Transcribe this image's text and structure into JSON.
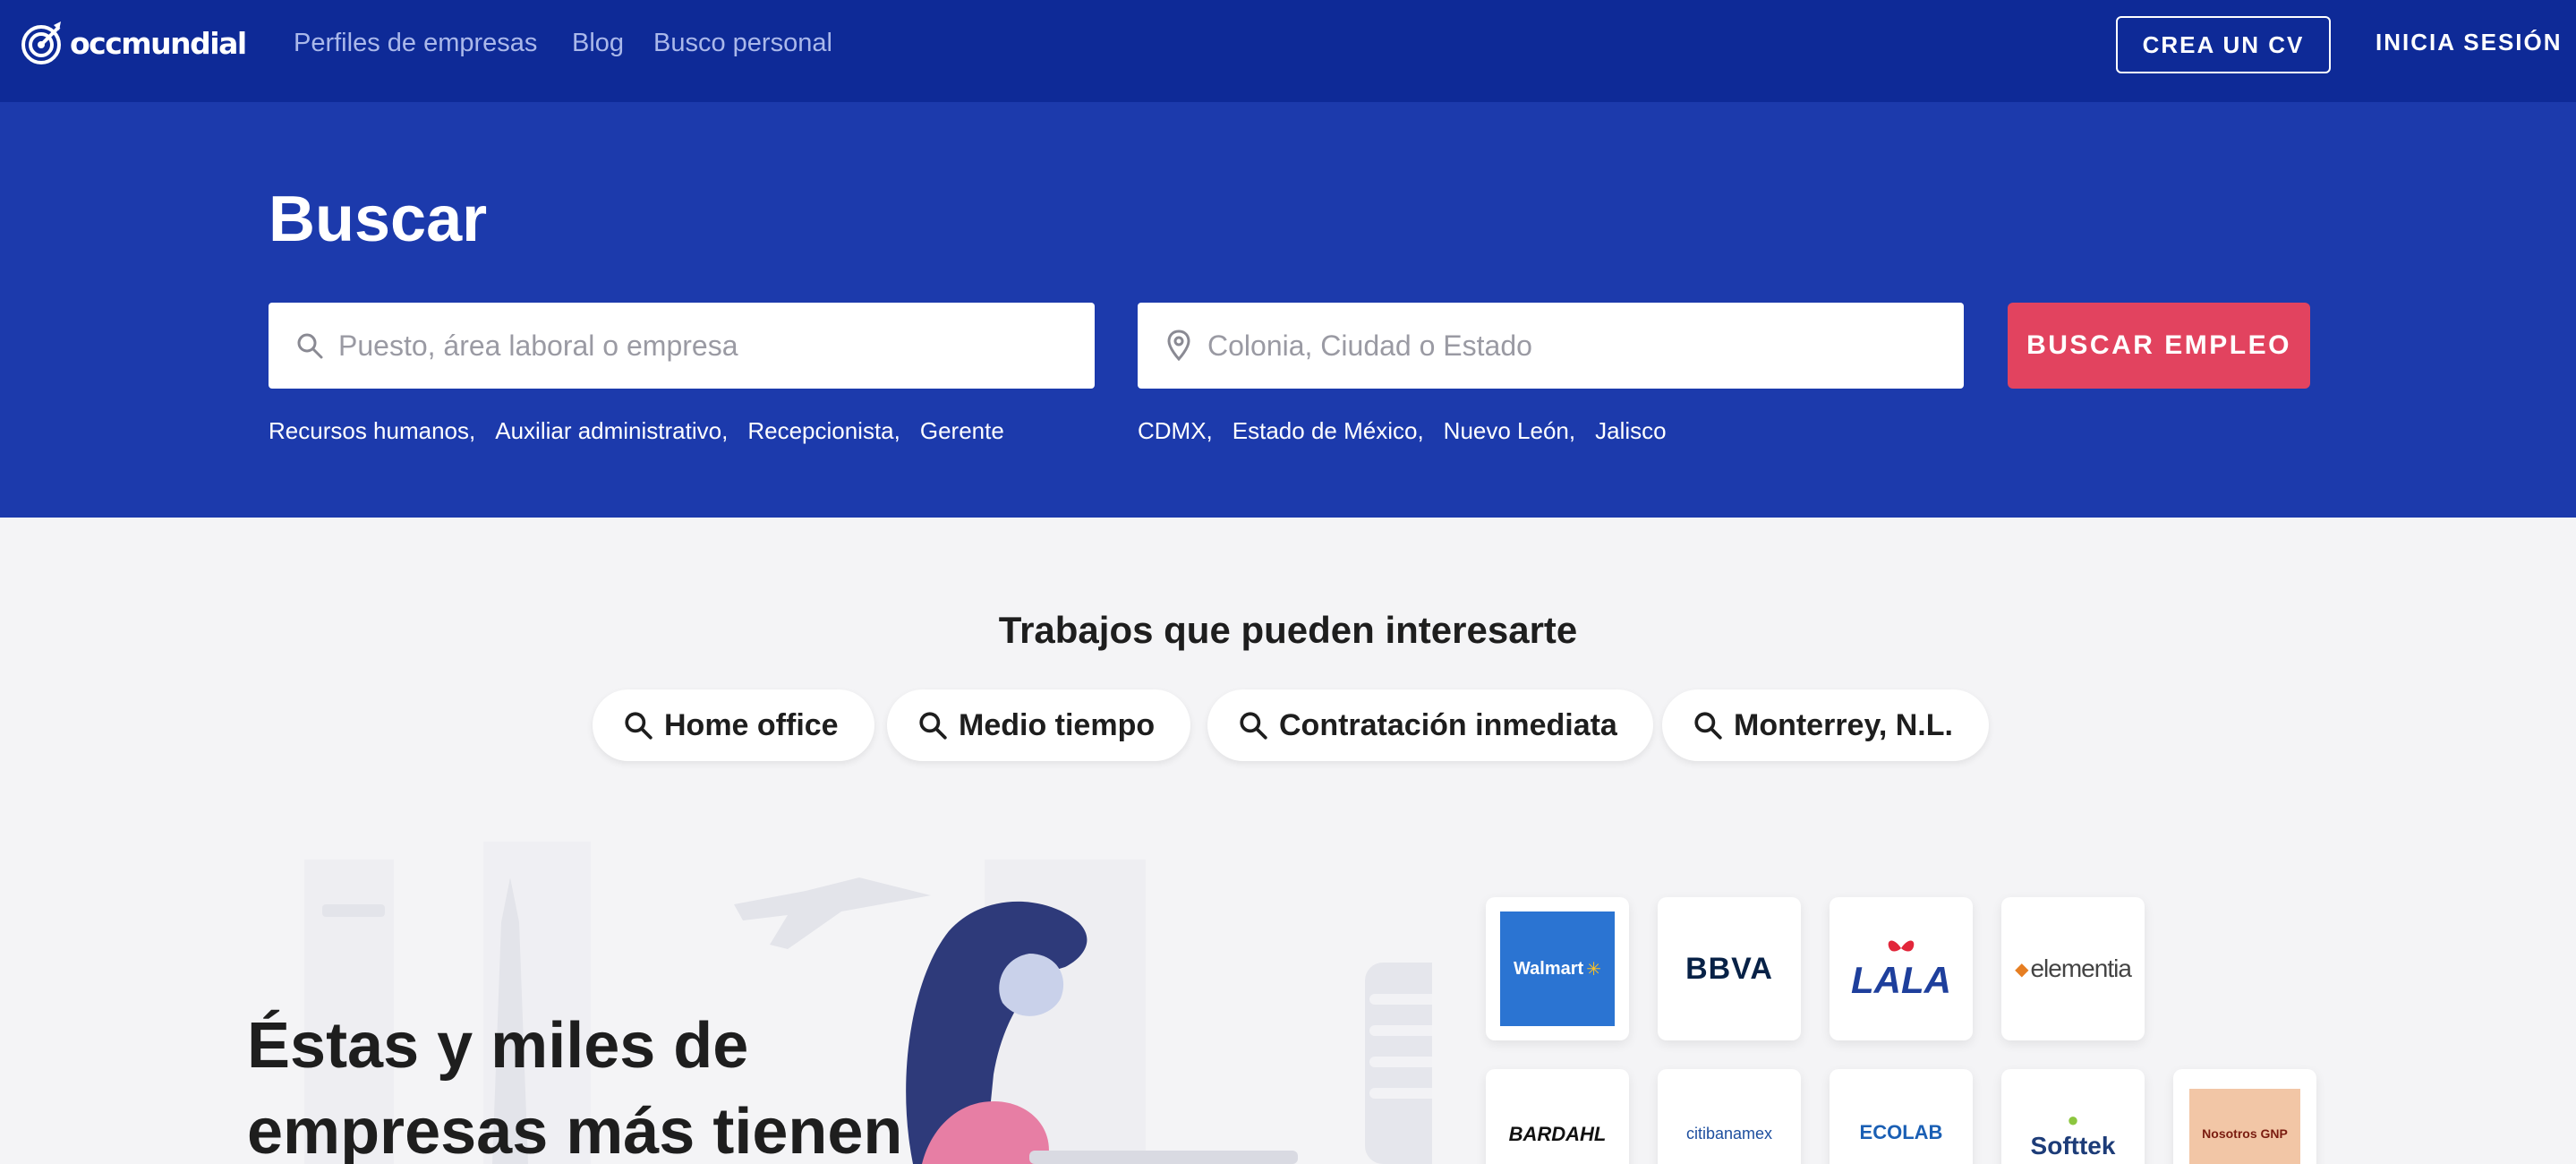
{
  "nav": {
    "logo_text": "occmundial",
    "links": [
      "Perfiles de empresas",
      "Blog",
      "Busco personal"
    ],
    "cv_button": "CREA UN CV",
    "login": "INICIA SESIÓN"
  },
  "hero": {
    "title": "Buscar",
    "search_placeholder": "Puesto, área laboral o empresa",
    "location_placeholder": "Colonia, Ciudad o Estado",
    "search_button": "BUSCAR EMPLEO",
    "job_suggestions": [
      "Recursos humanos,",
      "Auxiliar administrativo,",
      "Recepcionista,",
      "Gerente"
    ],
    "location_suggestions": [
      "CDMX,",
      "Estado de México,",
      "Nuevo León,",
      "Jalisco"
    ]
  },
  "interests": {
    "title": "Trabajos que pueden interesarte",
    "chips": [
      "Home office",
      "Medio tiempo",
      "Contratación inmediata",
      "Monterrey, N.L."
    ]
  },
  "companies": {
    "heading_line1": "Éstas y miles de",
    "heading_line2": "empresas más tienen",
    "logos": [
      "Walmart",
      "BBVA",
      "LALA",
      "elementia",
      "BARDAHL",
      "citibanamex",
      "ECOLAB",
      "Softtek",
      "Nosotros GNP"
    ]
  },
  "colors": {
    "nav_bg": "#0e2a97",
    "hero_bg": "#1c3aac",
    "accent": "#e2435f"
  }
}
